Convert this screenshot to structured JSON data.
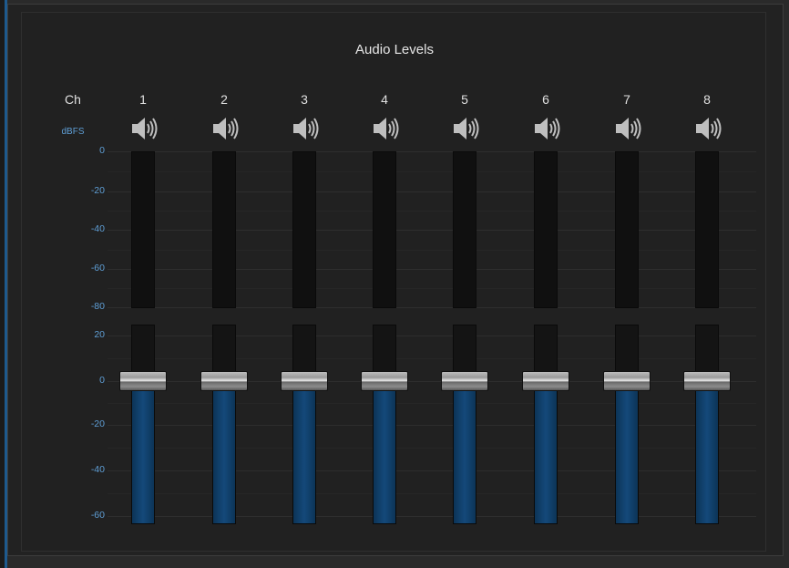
{
  "panel": {
    "title": "Audio Levels",
    "channel_header": "Ch",
    "unit_label": "dBFS"
  },
  "meter_scale": [
    "0",
    "-20",
    "-40",
    "-60",
    "-80"
  ],
  "fader_scale": [
    "20",
    "0",
    "-20",
    "-40",
    "-60"
  ],
  "channels": [
    {
      "number": "1",
      "fader_db": 0,
      "mute_icon": "speaker-icon"
    },
    {
      "number": "2",
      "fader_db": 0,
      "mute_icon": "speaker-icon"
    },
    {
      "number": "3",
      "fader_db": 0,
      "mute_icon": "speaker-icon"
    },
    {
      "number": "4",
      "fader_db": 0,
      "mute_icon": "speaker-icon"
    },
    {
      "number": "5",
      "fader_db": 0,
      "mute_icon": "speaker-icon"
    },
    {
      "number": "6",
      "fader_db": 0,
      "mute_icon": "speaker-icon"
    },
    {
      "number": "7",
      "fader_db": 0,
      "mute_icon": "speaker-icon"
    },
    {
      "number": "8",
      "fader_db": 0,
      "mute_icon": "speaker-icon"
    }
  ],
  "colors": {
    "accent_label": "#5f9fd6",
    "fader_fill": "#14497a"
  }
}
